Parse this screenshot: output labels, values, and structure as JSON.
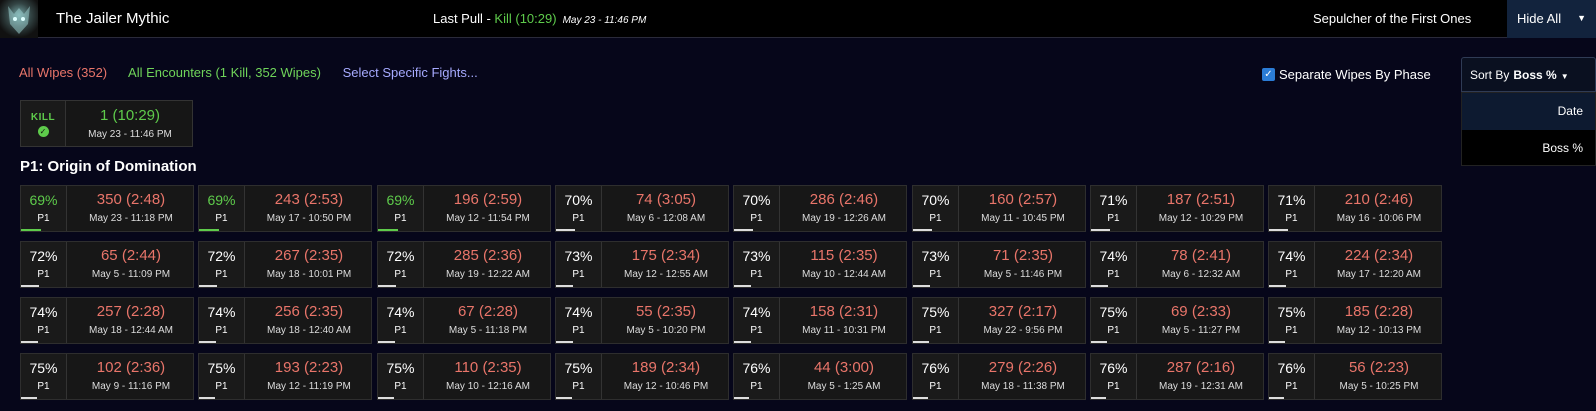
{
  "header": {
    "boss_name": "The Jailer Mythic",
    "last_pull_label": "Last Pull - ",
    "last_pull_kill": "Kill (10:29)",
    "last_pull_date": "May 23 - 11:46 PM",
    "zone": "Sepulcher of the First Ones",
    "hide_all": "Hide All"
  },
  "filters": {
    "all_wipes": "All Wipes (352)",
    "all_encounters": "All Encounters (1 Kill, 352 Wipes)",
    "select_fights": "Select Specific Fights..."
  },
  "options": {
    "separate_wipes": "Separate Wipes By Phase",
    "sort_by_label": "Sort By",
    "sort_by_value": "Boss %",
    "sort_options": [
      "Date",
      "Boss %"
    ]
  },
  "kill": {
    "label": "KILL",
    "title": "1 (10:29)",
    "date": "May 23 - 11:46 PM"
  },
  "phase_title": "P1: Origin of Domination",
  "colors": {
    "kill_green": "#5ecb4b",
    "wipe_red": "#e9756a",
    "accent_blue": "#2b7cd6"
  },
  "wipes": [
    {
      "pct": "69%",
      "phase": "P1",
      "title": "350 (2:48)",
      "date": "May 23 - 11:18 PM",
      "best": true
    },
    {
      "pct": "69%",
      "phase": "P1",
      "title": "243 (2:53)",
      "date": "May 17 - 10:50 PM",
      "best": true
    },
    {
      "pct": "69%",
      "phase": "P1",
      "title": "196 (2:59)",
      "date": "May 12 - 11:54 PM",
      "best": true
    },
    {
      "pct": "70%",
      "phase": "P1",
      "title": "74 (3:05)",
      "date": "May 6 - 12:08 AM"
    },
    {
      "pct": "70%",
      "phase": "P1",
      "title": "286 (2:46)",
      "date": "May 19 - 12:26 AM"
    },
    {
      "pct": "70%",
      "phase": "P1",
      "title": "160 (2:57)",
      "date": "May 11 - 10:45 PM"
    },
    {
      "pct": "71%",
      "phase": "P1",
      "title": "187 (2:51)",
      "date": "May 12 - 10:29 PM"
    },
    {
      "pct": "71%",
      "phase": "P1",
      "title": "210 (2:46)",
      "date": "May 16 - 10:06 PM"
    },
    {
      "pct": "72%",
      "phase": "P1",
      "title": "65 (2:44)",
      "date": "May 5 - 11:09 PM"
    },
    {
      "pct": "72%",
      "phase": "P1",
      "title": "267 (2:35)",
      "date": "May 18 - 10:01 PM"
    },
    {
      "pct": "72%",
      "phase": "P1",
      "title": "285 (2:36)",
      "date": "May 19 - 12:22 AM"
    },
    {
      "pct": "73%",
      "phase": "P1",
      "title": "175 (2:34)",
      "date": "May 12 - 12:55 AM"
    },
    {
      "pct": "73%",
      "phase": "P1",
      "title": "115 (2:35)",
      "date": "May 10 - 12:44 AM"
    },
    {
      "pct": "73%",
      "phase": "P1",
      "title": "71 (2:35)",
      "date": "May 5 - 11:46 PM"
    },
    {
      "pct": "74%",
      "phase": "P1",
      "title": "78 (2:41)",
      "date": "May 6 - 12:32 AM"
    },
    {
      "pct": "74%",
      "phase": "P1",
      "title": "224 (2:34)",
      "date": "May 17 - 12:20 AM"
    },
    {
      "pct": "74%",
      "phase": "P1",
      "title": "257 (2:28)",
      "date": "May 18 - 12:44 AM"
    },
    {
      "pct": "74%",
      "phase": "P1",
      "title": "256 (2:35)",
      "date": "May 18 - 12:40 AM"
    },
    {
      "pct": "74%",
      "phase": "P1",
      "title": "67 (2:28)",
      "date": "May 5 - 11:18 PM"
    },
    {
      "pct": "74%",
      "phase": "P1",
      "title": "55 (2:35)",
      "date": "May 5 - 10:20 PM"
    },
    {
      "pct": "74%",
      "phase": "P1",
      "title": "158 (2:31)",
      "date": "May 11 - 10:31 PM"
    },
    {
      "pct": "75%",
      "phase": "P1",
      "title": "327 (2:17)",
      "date": "May 22 - 9:56 PM"
    },
    {
      "pct": "75%",
      "phase": "P1",
      "title": "69 (2:33)",
      "date": "May 5 - 11:27 PM"
    },
    {
      "pct": "75%",
      "phase": "P1",
      "title": "185 (2:28)",
      "date": "May 12 - 10:13 PM"
    },
    {
      "pct": "75%",
      "phase": "P1",
      "title": "102 (2:36)",
      "date": "May 9 - 11:16 PM"
    },
    {
      "pct": "75%",
      "phase": "P1",
      "title": "193 (2:23)",
      "date": "May 12 - 11:19 PM"
    },
    {
      "pct": "75%",
      "phase": "P1",
      "title": "110 (2:35)",
      "date": "May 10 - 12:16 AM"
    },
    {
      "pct": "75%",
      "phase": "P1",
      "title": "189 (2:34)",
      "date": "May 12 - 10:46 PM"
    },
    {
      "pct": "76%",
      "phase": "P1",
      "title": "44 (3:00)",
      "date": "May 5 - 1:25 AM"
    },
    {
      "pct": "76%",
      "phase": "P1",
      "title": "279 (2:26)",
      "date": "May 18 - 11:38 PM"
    },
    {
      "pct": "76%",
      "phase": "P1",
      "title": "287 (2:16)",
      "date": "May 19 - 12:31 AM"
    },
    {
      "pct": "76%",
      "phase": "P1",
      "title": "56 (2:23)",
      "date": "May 5 - 10:25 PM"
    }
  ]
}
